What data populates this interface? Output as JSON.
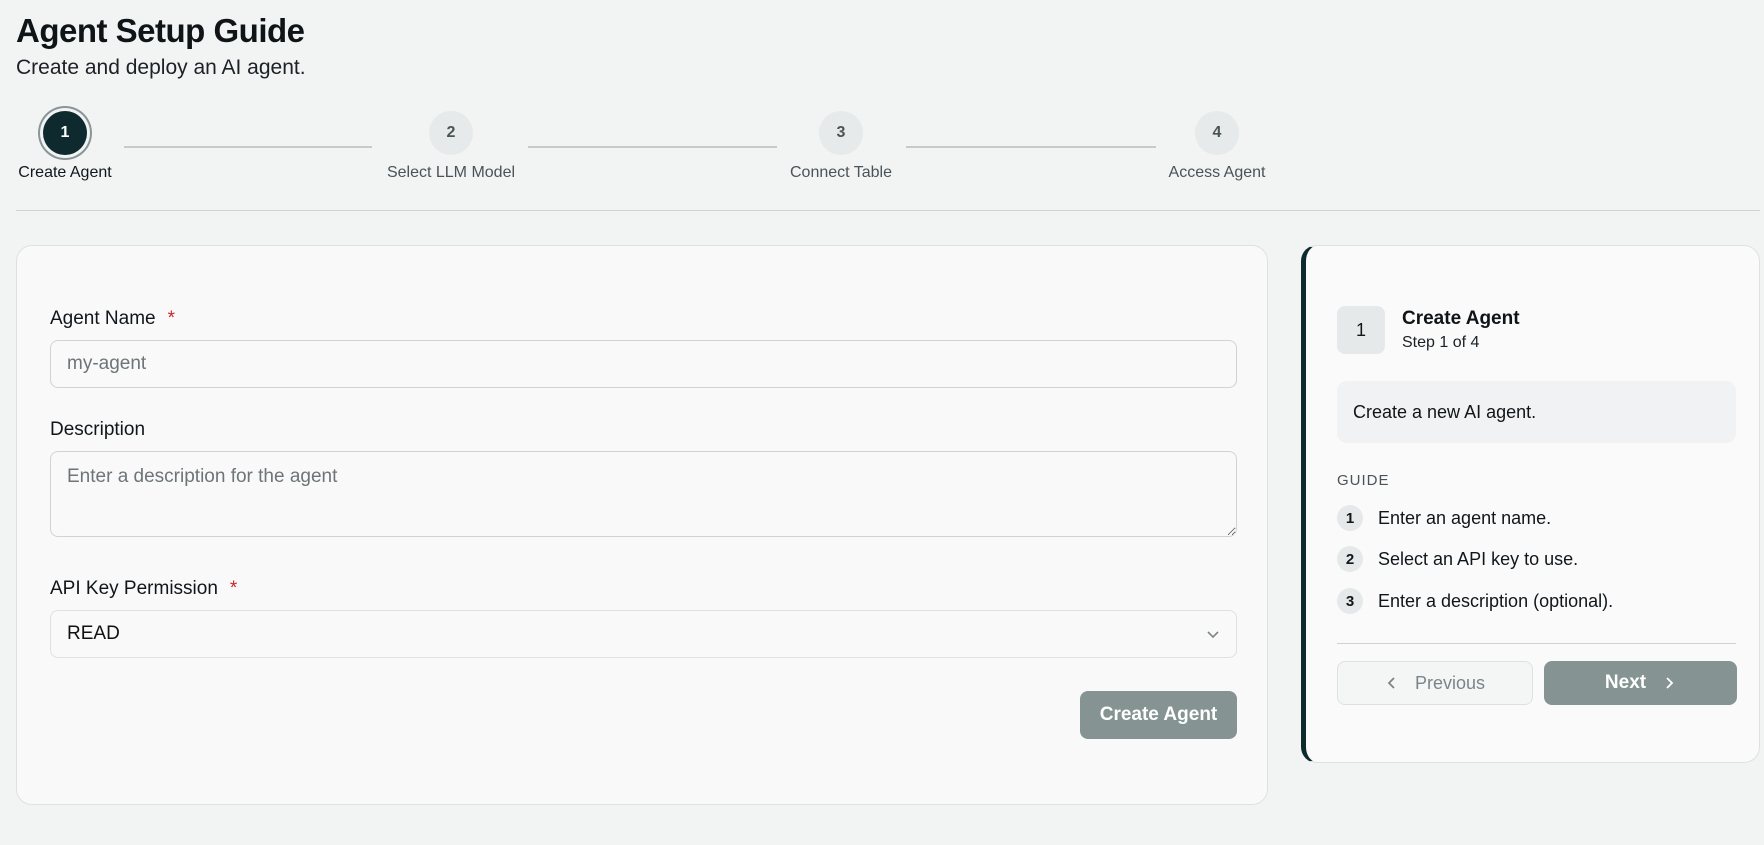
{
  "header": {
    "title": "Agent Setup Guide",
    "subtitle": "Create and deploy an AI agent."
  },
  "stepper": {
    "steps": [
      {
        "number": "1",
        "label": "Create Agent",
        "active": true
      },
      {
        "number": "2",
        "label": "Select LLM Model",
        "active": false
      },
      {
        "number": "3",
        "label": "Connect Table",
        "active": false
      },
      {
        "number": "4",
        "label": "Access Agent",
        "active": false
      }
    ]
  },
  "form": {
    "agent_name": {
      "label": "Agent Name",
      "required_mark": "*",
      "value": "",
      "placeholder": "my-agent"
    },
    "description": {
      "label": "Description",
      "value": "",
      "placeholder": "Enter a description for the agent"
    },
    "permission": {
      "label": "API Key Permission",
      "required_mark": "*",
      "selected": "READ"
    },
    "submit_label": "Create Agent"
  },
  "guide": {
    "step_number": "1",
    "title": "Create Agent",
    "progress": "Step 1 of 4",
    "description": "Create a new AI agent.",
    "heading": "GUIDE",
    "items": [
      {
        "number": "1",
        "text": "Enter an agent name."
      },
      {
        "number": "2",
        "text": "Select an API key to use."
      },
      {
        "number": "3",
        "text": "Enter a description (optional)."
      }
    ],
    "previous_label": "Previous",
    "next_label": "Next"
  },
  "colors": {
    "accent": "#0f2a2f",
    "button_disabled": "#859393",
    "required": "#c62828",
    "background": "#f2f4f3"
  },
  "icons": {
    "select_chevron": "chevron-down-icon",
    "previous": "chevron-left-icon",
    "next": "chevron-right-icon"
  }
}
